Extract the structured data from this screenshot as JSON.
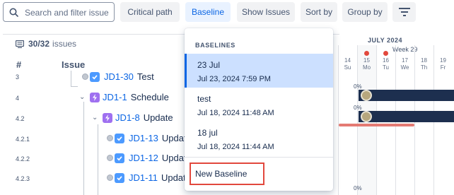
{
  "toolbar": {
    "search_placeholder": "Search and filter issue",
    "buttons": [
      {
        "label": "Critical path"
      },
      {
        "label": "Baseline"
      },
      {
        "label": "Show Issues"
      },
      {
        "label": "Sort by"
      },
      {
        "label": "Group by"
      }
    ]
  },
  "panel": {
    "count": "30/32",
    "count_label": "issues",
    "col_num": "#",
    "col_issue": "Issue"
  },
  "rows": [
    {
      "num": "3",
      "key": "JD1-30",
      "summary": "Test",
      "type": "task"
    },
    {
      "num": "4",
      "key": "JD1-1",
      "summary": "Schedule",
      "type": "epic"
    },
    {
      "num": "4.2",
      "key": "JD1-8",
      "summary": "Update",
      "type": "epic"
    },
    {
      "num": "4.2.1",
      "key": "JD1-13",
      "summary": "Update",
      "type": "task"
    },
    {
      "num": "4.2.2",
      "key": "JD1-12",
      "summary": "Update",
      "type": "task"
    },
    {
      "num": "4.2.3",
      "key": "JD1-11",
      "summary": "Update",
      "type": "task"
    }
  ],
  "timeline": {
    "month": "JULY 2024",
    "week": "Week 29",
    "days": [
      {
        "num": "14",
        "dow": "Su",
        "weekend": false,
        "marker": false
      },
      {
        "num": "15",
        "dow": "Mo",
        "weekend": false,
        "marker": true
      },
      {
        "num": "16",
        "dow": "Tu",
        "weekend": false,
        "marker": true
      },
      {
        "num": "17",
        "dow": "We",
        "weekend": false,
        "marker": false
      },
      {
        "num": "18",
        "dow": "Th",
        "weekend": false,
        "marker": false
      },
      {
        "num": "19",
        "dow": "Fr",
        "weekend": false,
        "marker": false
      }
    ],
    "progress_labels": [
      "0%",
      "0%",
      "0%"
    ]
  },
  "baselines": {
    "header": "BASELINES",
    "items": [
      {
        "name": "23 Jul",
        "date": "Jul 23, 2024 7:59 PM",
        "selected": true
      },
      {
        "name": "test",
        "date": "Jul 18, 2024 11:48 AM",
        "selected": false
      },
      {
        "name": "18 jul",
        "date": "Jul 18, 2024 11:44 AM",
        "selected": false
      }
    ],
    "new_label": "New Baseline"
  },
  "colors": {
    "accent": "#0c66e4",
    "bar": "#1d2f4f",
    "highlight": "#e2483d",
    "selected_bg": "#cce0ff"
  }
}
